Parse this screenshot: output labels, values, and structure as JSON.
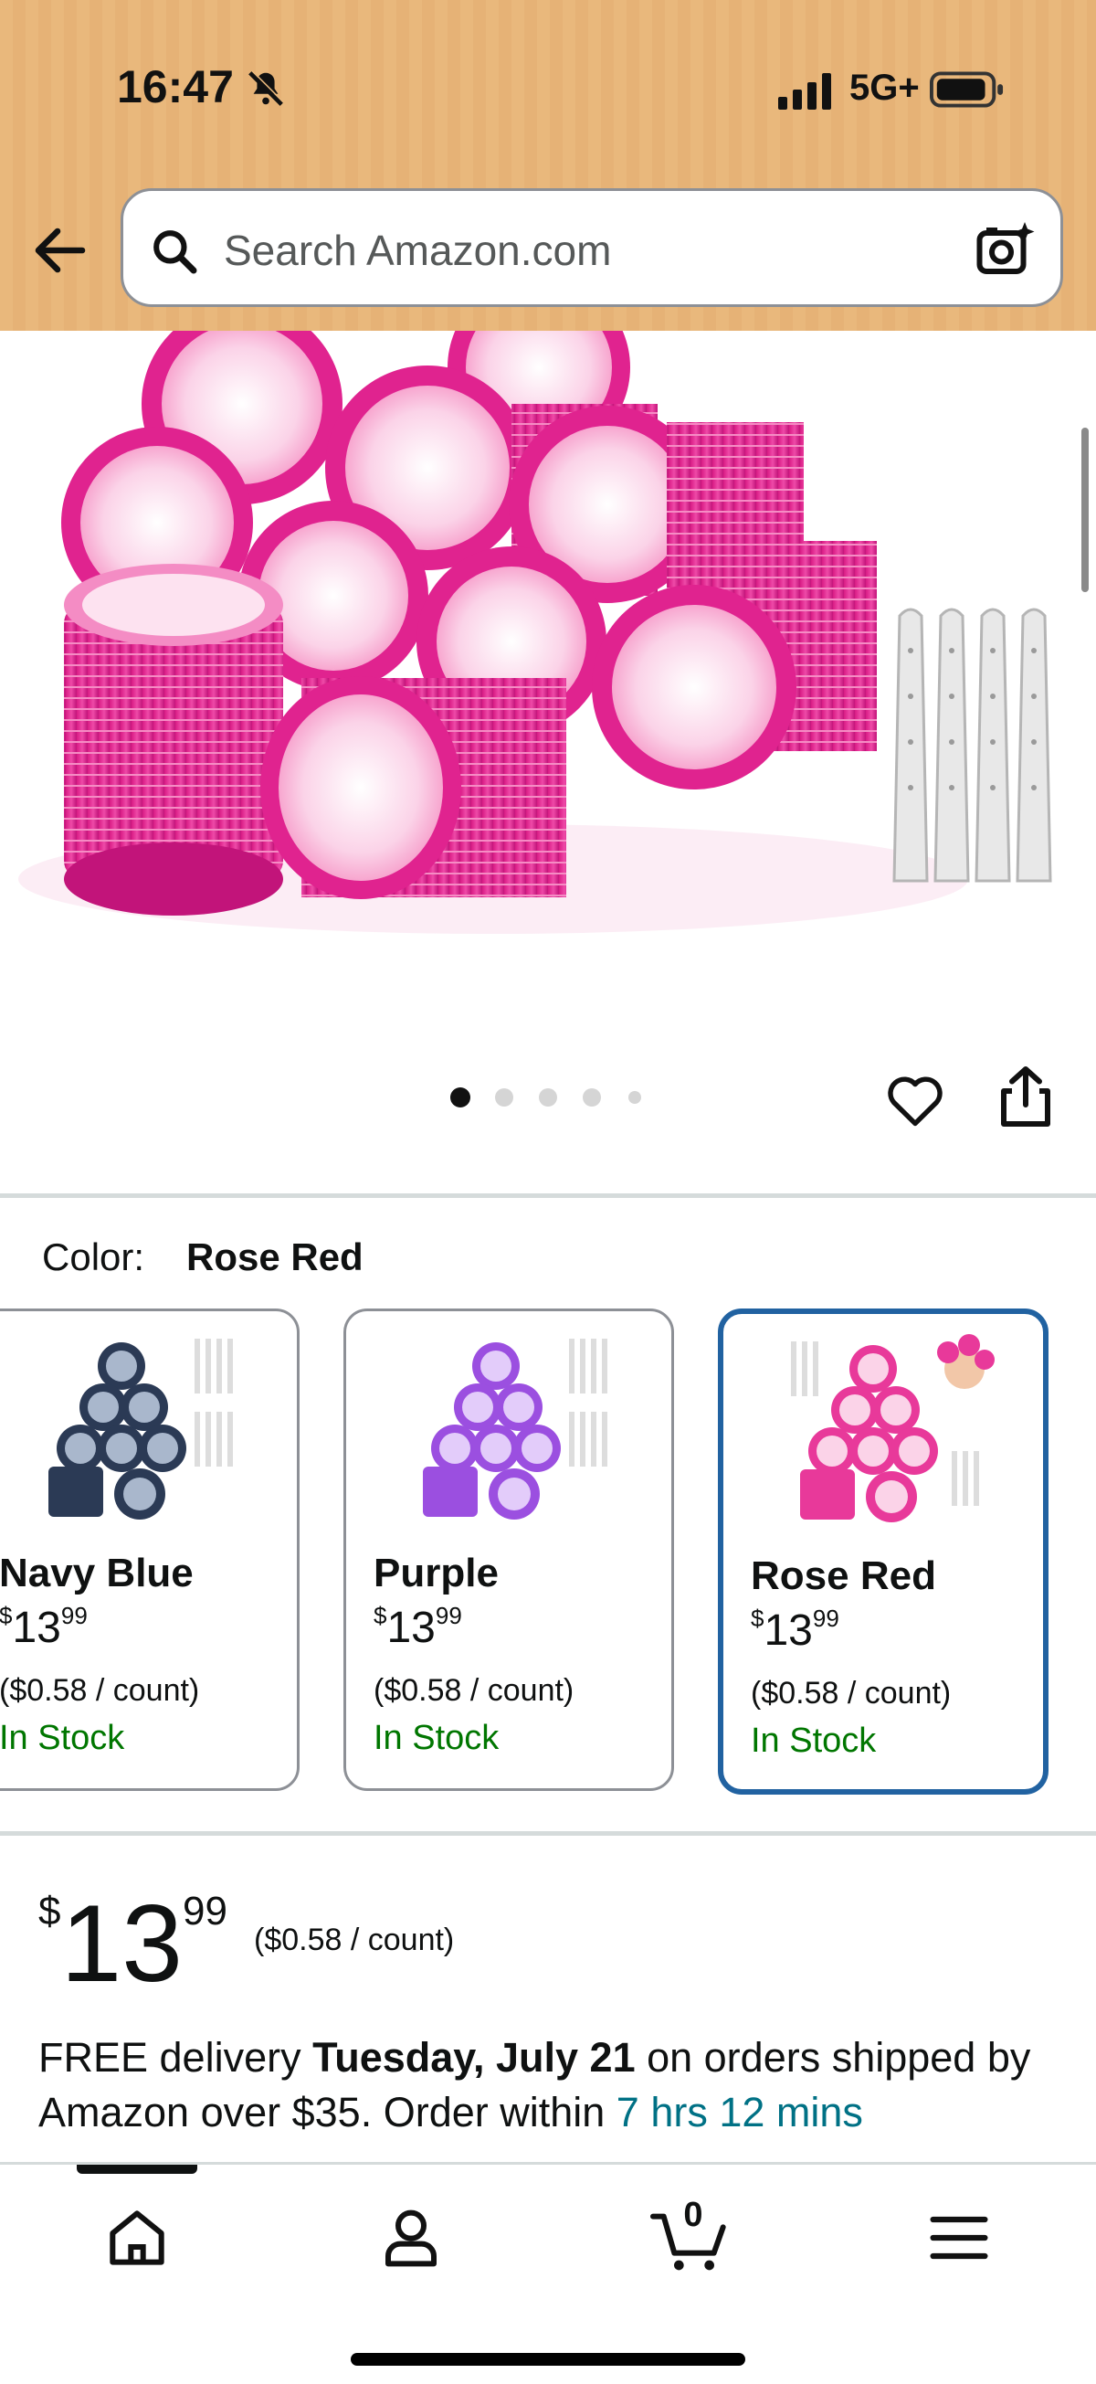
{
  "status_bar": {
    "time": "16:47",
    "network": "5G+"
  },
  "search": {
    "placeholder": "Search Amazon.com"
  },
  "gallery": {
    "current_index": 1,
    "total_images": 5
  },
  "color": {
    "label": "Color:",
    "selected": "Rose Red",
    "options": [
      {
        "name": "Navy Blue",
        "price_dollars": "13",
        "price_cents": "99",
        "currency": "$",
        "unit_price": "($0.58 / count)",
        "stock": "In Stock",
        "accent": "#2b3a55"
      },
      {
        "name": "Purple",
        "price_dollars": "13",
        "price_cents": "99",
        "currency": "$",
        "unit_price": "($0.58 / count)",
        "stock": "In Stock",
        "accent": "#9b4fe0"
      },
      {
        "name": "Rose Red",
        "price_dollars": "13",
        "price_cents": "99",
        "currency": "$",
        "unit_price": "($0.58 / count)",
        "stock": "In Stock",
        "accent": "#e8399a"
      }
    ]
  },
  "price": {
    "currency": "$",
    "dollars": "13",
    "cents": "99",
    "unit_price": "($0.58 / count)"
  },
  "delivery": {
    "prefix": "FREE delivery ",
    "date": "Tuesday, July 21",
    "middle": " on orders shipped by Amazon over $35. Order within ",
    "countdown": "7 hrs 12 mins"
  },
  "nav": {
    "cart_count": "0"
  },
  "colors": {
    "header_bg": "#e9b87c",
    "link": "#007185",
    "in_stock": "#007600",
    "selected_border": "#2162a1"
  }
}
